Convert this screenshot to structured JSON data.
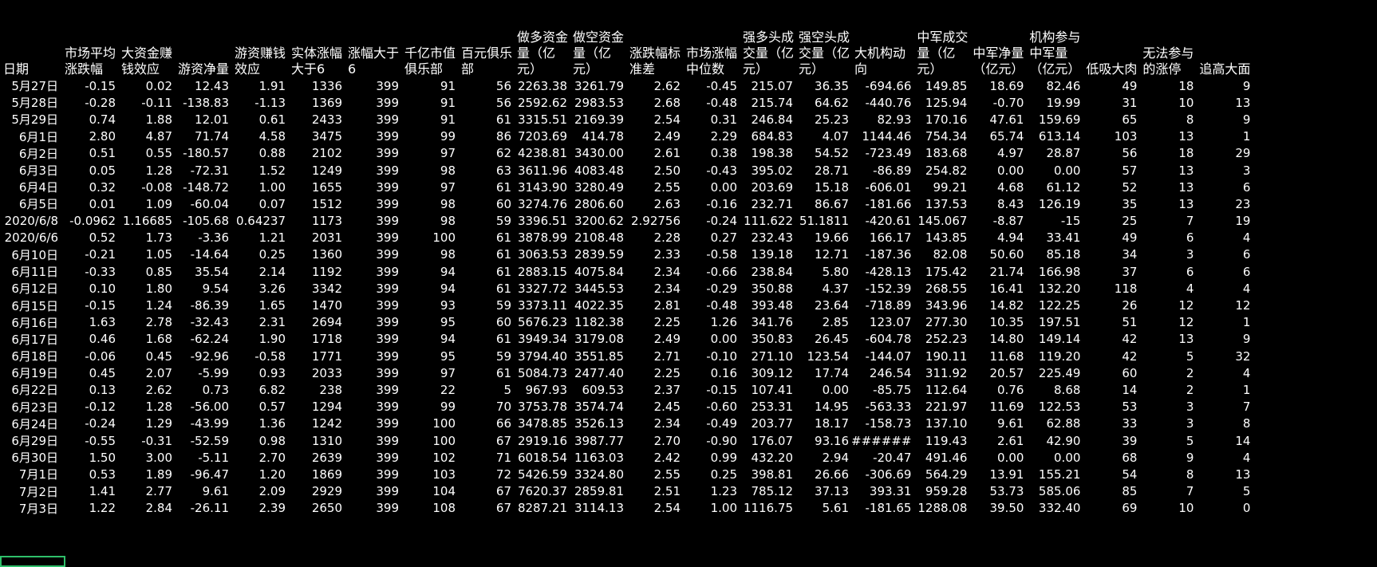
{
  "headers": [
    "日期",
    "市场平均涨跌幅",
    "大资金赚钱效应",
    "游资净量",
    "游资赚钱效应",
    "实体涨幅大于6",
    "涨幅大于6",
    "千亿市值俱乐部",
    "百元俱乐部",
    "做多资金量（亿元）",
    "做空资金量（亿元）",
    "涨跌幅标准差",
    "市场涨幅中位数",
    "强多头成交量（亿元）",
    "强空头成交量（亿元）",
    "大机构动向",
    "中军成交量（亿元）",
    "中军净量（亿元）",
    "机构参与中军量（亿元）",
    "低吸大肉",
    "无法参与的涨停",
    "追高大面"
  ],
  "rows": [
    [
      "5月27日",
      "-0.15",
      "0.02",
      "12.43",
      "1.91",
      "1336",
      "399",
      "91",
      "56",
      "2263.38",
      "3261.79",
      "2.62",
      "-0.45",
      "215.07",
      "36.35",
      "-694.66",
      "149.85",
      "18.69",
      "82.46",
      "49",
      "18",
      "9"
    ],
    [
      "5月28日",
      "-0.28",
      "-0.11",
      "-138.83",
      "-1.13",
      "1369",
      "399",
      "91",
      "56",
      "2592.62",
      "2983.53",
      "2.68",
      "-0.48",
      "215.74",
      "64.62",
      "-440.76",
      "125.94",
      "-0.70",
      "19.99",
      "31",
      "10",
      "13"
    ],
    [
      "5月29日",
      "0.74",
      "1.88",
      "12.01",
      "0.61",
      "2433",
      "399",
      "91",
      "61",
      "3315.51",
      "2169.39",
      "2.54",
      "0.31",
      "246.84",
      "25.23",
      "82.93",
      "170.16",
      "47.61",
      "159.69",
      "65",
      "8",
      "9"
    ],
    [
      "6月1日",
      "2.80",
      "4.87",
      "71.74",
      "4.58",
      "3475",
      "399",
      "99",
      "86",
      "7203.69",
      "414.78",
      "2.49",
      "2.29",
      "684.83",
      "4.07",
      "1144.46",
      "754.34",
      "65.74",
      "613.14",
      "103",
      "13",
      "1"
    ],
    [
      "6月2日",
      "0.51",
      "0.55",
      "-180.57",
      "0.88",
      "2102",
      "399",
      "97",
      "62",
      "4238.81",
      "3430.00",
      "2.61",
      "0.38",
      "198.38",
      "54.52",
      "-723.49",
      "183.68",
      "4.97",
      "28.87",
      "56",
      "18",
      "29"
    ],
    [
      "6月3日",
      "0.05",
      "1.28",
      "-72.31",
      "1.52",
      "1249",
      "399",
      "98",
      "63",
      "3611.96",
      "4083.48",
      "2.50",
      "-0.43",
      "395.02",
      "28.71",
      "-86.89",
      "254.82",
      "0.00",
      "0.00",
      "57",
      "13",
      "3"
    ],
    [
      "6月4日",
      "0.32",
      "-0.08",
      "-148.72",
      "1.00",
      "1655",
      "399",
      "97",
      "61",
      "3143.90",
      "3280.49",
      "2.55",
      "0.00",
      "203.69",
      "15.18",
      "-606.01",
      "99.21",
      "4.68",
      "61.12",
      "52",
      "13",
      "6"
    ],
    [
      "6月5日",
      "0.01",
      "1.09",
      "-60.04",
      "0.07",
      "1512",
      "399",
      "98",
      "60",
      "3274.76",
      "2806.60",
      "2.63",
      "-0.16",
      "232.71",
      "86.67",
      "-181.66",
      "137.53",
      "8.43",
      "126.19",
      "35",
      "13",
      "23"
    ],
    [
      "2020/6/8",
      "-0.0962",
      "1.16685",
      "-105.68",
      "0.64237",
      "1173",
      "399",
      "98",
      "59",
      "3396.51",
      "3200.62",
      "2.92756",
      "-0.24",
      "111.622",
      "51.1811",
      "-420.61",
      "145.067",
      "-8.87",
      "-15",
      "25",
      "7",
      "19"
    ],
    [
      "2020/6/6",
      "0.52",
      "1.73",
      "-3.36",
      "1.21",
      "2031",
      "399",
      "100",
      "61",
      "3878.99",
      "2108.48",
      "2.28",
      "0.27",
      "232.43",
      "19.66",
      "166.17",
      "143.85",
      "4.94",
      "33.41",
      "49",
      "6",
      "4"
    ],
    [
      "6月10日",
      "-0.21",
      "1.05",
      "-14.64",
      "0.25",
      "1360",
      "399",
      "98",
      "61",
      "3063.53",
      "2839.59",
      "2.33",
      "-0.58",
      "139.18",
      "12.71",
      "-187.36",
      "82.08",
      "50.60",
      "85.18",
      "34",
      "3",
      "6"
    ],
    [
      "6月11日",
      "-0.33",
      "0.85",
      "35.54",
      "2.14",
      "1192",
      "399",
      "94",
      "61",
      "2883.15",
      "4075.84",
      "2.34",
      "-0.66",
      "238.84",
      "5.80",
      "-428.13",
      "175.42",
      "21.74",
      "166.98",
      "37",
      "6",
      "6"
    ],
    [
      "6月12日",
      "0.10",
      "1.80",
      "9.54",
      "3.26",
      "3342",
      "399",
      "94",
      "61",
      "3327.72",
      "3445.53",
      "2.34",
      "-0.29",
      "350.88",
      "4.37",
      "-152.39",
      "268.55",
      "16.41",
      "132.20",
      "118",
      "4",
      "4"
    ],
    [
      "6月15日",
      "-0.15",
      "1.24",
      "-86.39",
      "1.65",
      "1470",
      "399",
      "93",
      "59",
      "3373.11",
      "4022.35",
      "2.81",
      "-0.48",
      "393.48",
      "23.64",
      "-718.89",
      "343.96",
      "14.82",
      "122.25",
      "26",
      "12",
      "12"
    ],
    [
      "6月16日",
      "1.63",
      "2.78",
      "-32.43",
      "2.31",
      "2694",
      "399",
      "95",
      "60",
      "5676.23",
      "1182.38",
      "2.25",
      "1.26",
      "341.76",
      "2.85",
      "123.07",
      "277.30",
      "10.35",
      "197.51",
      "51",
      "12",
      "1"
    ],
    [
      "6月17日",
      "0.46",
      "1.68",
      "-62.24",
      "1.90",
      "1718",
      "399",
      "94",
      "61",
      "3949.34",
      "3179.08",
      "2.49",
      "0.00",
      "350.83",
      "26.45",
      "-604.78",
      "252.23",
      "14.80",
      "149.14",
      "42",
      "13",
      "9"
    ],
    [
      "6月18日",
      "-0.06",
      "0.45",
      "-92.96",
      "-0.58",
      "1771",
      "399",
      "95",
      "59",
      "3794.40",
      "3551.85",
      "2.71",
      "-0.10",
      "271.10",
      "123.54",
      "-144.07",
      "190.11",
      "11.68",
      "119.20",
      "42",
      "5",
      "32"
    ],
    [
      "6月19日",
      "0.45",
      "2.07",
      "-5.99",
      "0.93",
      "2033",
      "399",
      "97",
      "61",
      "5084.73",
      "2477.40",
      "2.25",
      "0.16",
      "309.12",
      "17.74",
      "246.54",
      "311.92",
      "20.57",
      "225.49",
      "60",
      "2",
      "4"
    ],
    [
      "6月22日",
      "0.13",
      "2.62",
      "0.73",
      "6.82",
      "238",
      "399",
      "22",
      "5",
      "967.93",
      "609.53",
      "2.37",
      "-0.15",
      "107.41",
      "0.00",
      "-85.75",
      "112.64",
      "0.76",
      "8.68",
      "14",
      "2",
      "1"
    ],
    [
      "6月23日",
      "-0.12",
      "1.28",
      "-56.00",
      "0.57",
      "1294",
      "399",
      "99",
      "70",
      "3753.78",
      "3574.74",
      "2.45",
      "-0.60",
      "253.31",
      "14.95",
      "-563.33",
      "221.97",
      "11.69",
      "122.53",
      "53",
      "3",
      "7"
    ],
    [
      "6月24日",
      "-0.24",
      "1.29",
      "-43.99",
      "1.36",
      "1242",
      "399",
      "100",
      "66",
      "3478.85",
      "3526.13",
      "2.34",
      "-0.49",
      "203.77",
      "18.17",
      "-158.73",
      "137.10",
      "9.61",
      "62.88",
      "33",
      "3",
      "8"
    ],
    [
      "6月29日",
      "-0.55",
      "-0.31",
      "-52.59",
      "0.98",
      "1310",
      "399",
      "100",
      "67",
      "2919.16",
      "3987.77",
      "2.70",
      "-0.90",
      "176.07",
      "93.16",
      "######",
      "119.43",
      "2.61",
      "42.90",
      "39",
      "5",
      "14"
    ],
    [
      "6月30日",
      "1.50",
      "3.00",
      "-5.11",
      "2.70",
      "2639",
      "399",
      "102",
      "71",
      "6018.54",
      "1163.03",
      "2.42",
      "0.99",
      "432.20",
      "2.94",
      "-20.47",
      "491.46",
      "0.00",
      "0.00",
      "68",
      "9",
      "4"
    ],
    [
      "7月1日",
      "0.53",
      "1.89",
      "-96.47",
      "1.20",
      "1869",
      "399",
      "103",
      "72",
      "5426.59",
      "3324.80",
      "2.55",
      "0.25",
      "398.81",
      "26.66",
      "-306.69",
      "564.29",
      "13.91",
      "155.21",
      "54",
      "8",
      "13"
    ],
    [
      "7月2日",
      "1.41",
      "2.77",
      "9.61",
      "2.09",
      "2929",
      "399",
      "104",
      "67",
      "7620.37",
      "2859.81",
      "2.51",
      "1.23",
      "785.12",
      "37.13",
      "393.31",
      "959.28",
      "53.73",
      "585.06",
      "85",
      "7",
      "5"
    ],
    [
      "7月3日",
      "1.22",
      "2.84",
      "-26.11",
      "2.39",
      "2650",
      "399",
      "108",
      "67",
      "8287.21",
      "3114.13",
      "2.54",
      "1.00",
      "1116.75",
      "5.61",
      "-181.65",
      "1288.08",
      "39.50",
      "332.40",
      "69",
      "10",
      "0"
    ]
  ]
}
